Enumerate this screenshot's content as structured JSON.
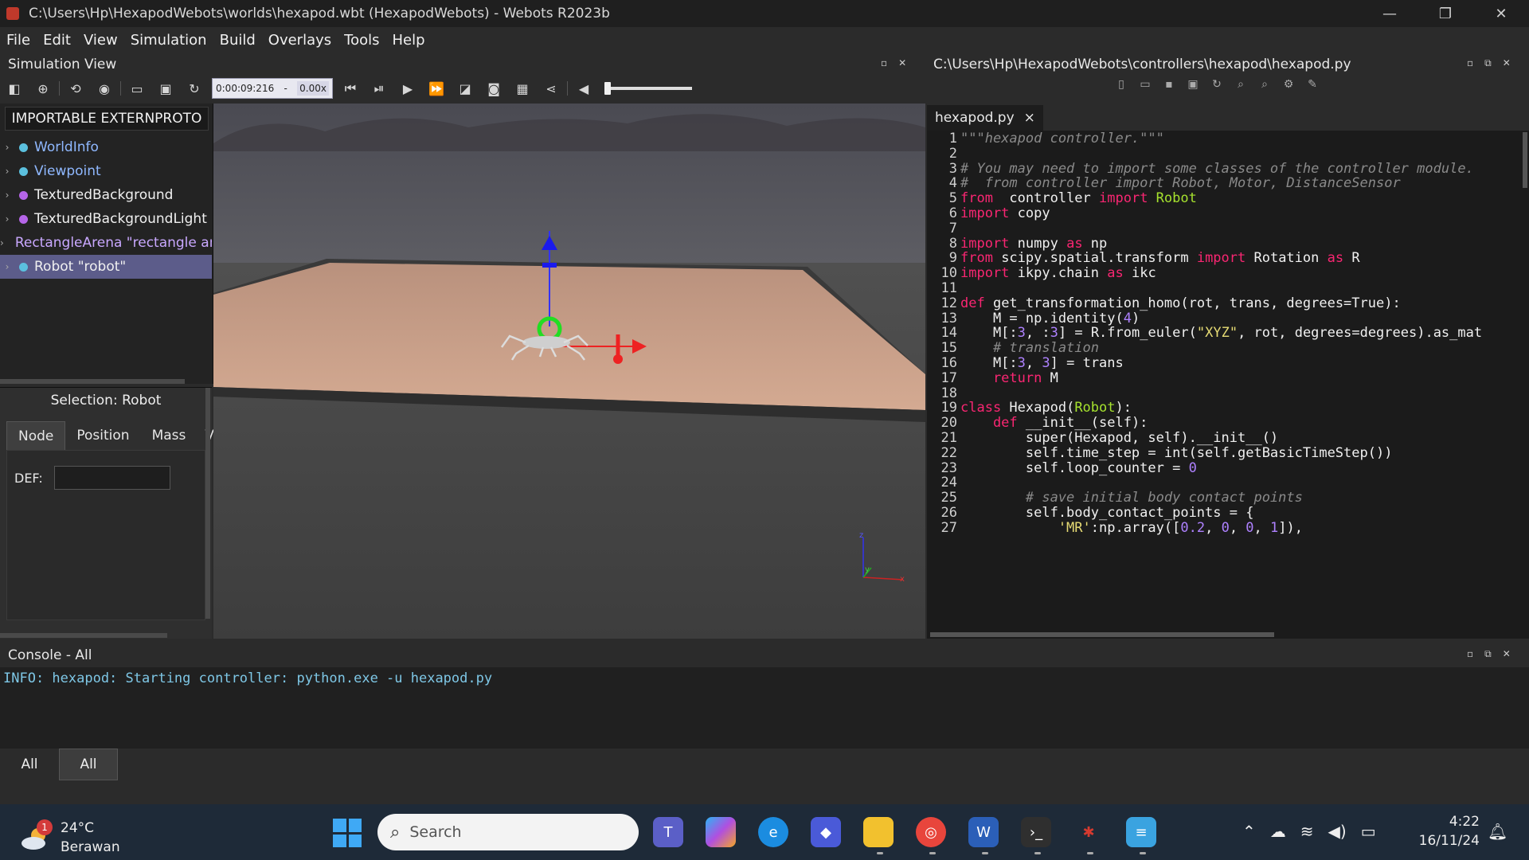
{
  "window": {
    "title": "C:\\Users\\Hp\\HexapodWebots\\worlds\\hexapod.wbt (HexapodWebots) - Webots R2023b",
    "controls": [
      "—",
      "❐",
      "✕"
    ]
  },
  "menu": [
    "File",
    "Edit",
    "View",
    "Simulation",
    "Build",
    "Overlays",
    "Tools",
    "Help"
  ],
  "sim_view": {
    "title": "Simulation View",
    "time": "0:00:09:216",
    "speed_sep": "-",
    "speed": "0.00x",
    "volume_level": 0.0
  },
  "scene_tree": {
    "proto_button": "IMPORTABLE EXTERNPROTO",
    "items": [
      {
        "label": "WorldInfo",
        "color": "#5bc0de",
        "text_color": "#8fb8ff"
      },
      {
        "label": "Viewpoint",
        "color": "#5bc0de",
        "text_color": "#8fb8ff"
      },
      {
        "label": "TexturedBackground",
        "color": "#b565e8",
        "text_color": "#f0f0f0"
      },
      {
        "label": "TexturedBackgroundLight",
        "color": "#b565e8",
        "text_color": "#f0f0f0"
      },
      {
        "label": "RectangleArena \"rectangle ar",
        "color": "#b565e8",
        "text_color": "#c9a8ff"
      },
      {
        "label": "Robot \"robot\"",
        "color": "#5bc0de",
        "text_color": "#f0f0f0",
        "selected": true
      }
    ]
  },
  "field_editor": {
    "selection": "Selection: Robot",
    "tabs": [
      "Node",
      "Position",
      "Mass",
      "V"
    ],
    "def_label": "DEF:",
    "def_value": ""
  },
  "viewport": {
    "axis_labels": {
      "z": "z",
      "y": "y",
      "x": "x"
    }
  },
  "editor": {
    "path": "C:\\Users\\Hp\\HexapodWebots\\controllers\\hexapod\\hexapod.py",
    "tab_name": "hexapod.py",
    "tab_close": "×",
    "lines": [
      {
        "n": "1",
        "segs": [
          [
            "cm",
            "\"\"\"hexapod controller.\"\"\""
          ]
        ]
      },
      {
        "n": "2",
        "segs": []
      },
      {
        "n": "3",
        "segs": [
          [
            "cm",
            "# You may need to import some classes of the controller module."
          ]
        ]
      },
      {
        "n": "4",
        "segs": [
          [
            "cm",
            "#  from controller import Robot, Motor, DistanceSensor"
          ]
        ]
      },
      {
        "n": "5",
        "segs": [
          [
            "kw",
            "from"
          ],
          [
            "",
            "  controller "
          ],
          [
            "kw",
            "import"
          ],
          [
            "cls",
            " Robot"
          ]
        ]
      },
      {
        "n": "6",
        "segs": [
          [
            "kw",
            "import"
          ],
          [
            "",
            " copy"
          ]
        ]
      },
      {
        "n": "7",
        "segs": []
      },
      {
        "n": "8",
        "segs": [
          [
            "kw",
            "import"
          ],
          [
            "",
            " numpy "
          ],
          [
            "kw",
            "as"
          ],
          [
            "",
            " np"
          ]
        ]
      },
      {
        "n": "9",
        "segs": [
          [
            "kw",
            "from"
          ],
          [
            "",
            " scipy.spatial.transform "
          ],
          [
            "kw",
            "import"
          ],
          [
            "",
            " Rotation "
          ],
          [
            "kw",
            "as"
          ],
          [
            "",
            " R"
          ]
        ]
      },
      {
        "n": "10",
        "segs": [
          [
            "kw",
            "import"
          ],
          [
            "",
            " ikpy.chain "
          ],
          [
            "kw",
            "as"
          ],
          [
            "",
            " ikc"
          ]
        ]
      },
      {
        "n": "11",
        "segs": []
      },
      {
        "n": "12",
        "segs": [
          [
            "kw",
            "def"
          ],
          [
            "",
            " get_transformation_homo(rot, trans, degrees=True):"
          ]
        ]
      },
      {
        "n": "13",
        "segs": [
          [
            "",
            "    M = np.identity("
          ],
          [
            "nm",
            "4"
          ],
          [
            "",
            ")"
          ]
        ]
      },
      {
        "n": "14",
        "segs": [
          [
            "",
            "    M[:"
          ],
          [
            "nm",
            "3"
          ],
          [
            "",
            ", :"
          ],
          [
            "nm",
            "3"
          ],
          [
            "",
            "] = R.from_euler("
          ],
          [
            "st",
            "\"XYZ\""
          ],
          [
            "",
            ", rot, degrees=degrees).as_mat"
          ]
        ]
      },
      {
        "n": "15",
        "segs": [
          [
            "cm",
            "    # translation"
          ]
        ]
      },
      {
        "n": "16",
        "segs": [
          [
            "",
            "    M[:"
          ],
          [
            "nm",
            "3"
          ],
          [
            "",
            ", "
          ],
          [
            "nm",
            "3"
          ],
          [
            "",
            "] = trans"
          ]
        ]
      },
      {
        "n": "17",
        "segs": [
          [
            "kw",
            "    return"
          ],
          [
            "",
            " M"
          ]
        ]
      },
      {
        "n": "18",
        "segs": []
      },
      {
        "n": "19",
        "segs": [
          [
            "kw",
            "class"
          ],
          [
            "",
            " Hexapod("
          ],
          [
            "cls",
            "Robot"
          ],
          [
            "",
            "):"
          ]
        ]
      },
      {
        "n": "20",
        "segs": [
          [
            "kw",
            "    def"
          ],
          [
            "",
            " __init__(self):"
          ]
        ]
      },
      {
        "n": "21",
        "segs": [
          [
            "",
            "        super(Hexapod, self).__init__()"
          ]
        ]
      },
      {
        "n": "22",
        "segs": [
          [
            "",
            "        self.time_step = int(self.getBasicTimeStep())"
          ]
        ]
      },
      {
        "n": "23",
        "segs": [
          [
            "",
            "        self.loop_counter = "
          ],
          [
            "nm",
            "0"
          ]
        ]
      },
      {
        "n": "24",
        "segs": []
      },
      {
        "n": "25",
        "segs": [
          [
            "cm",
            "        # save initial body contact points"
          ]
        ]
      },
      {
        "n": "26",
        "segs": [
          [
            "",
            "        self.body_contact_points = {"
          ]
        ]
      },
      {
        "n": "27",
        "segs": [
          [
            "st",
            "            'MR'"
          ],
          [
            "",
            ":np.array(["
          ],
          [
            "nm",
            "0.2"
          ],
          [
            "",
            ", "
          ],
          [
            "nm",
            "0"
          ],
          [
            "",
            ", "
          ],
          [
            "nm",
            "0"
          ],
          [
            "",
            ", "
          ],
          [
            "nm",
            "1"
          ],
          [
            "",
            "]),"
          ]
        ]
      }
    ]
  },
  "console": {
    "title": "Console - All",
    "message": "INFO: hexapod: Starting controller: python.exe -u hexapod.py",
    "tabs": [
      "All",
      "All"
    ]
  },
  "taskbar": {
    "weather_badge": "1",
    "temperature": "24°C",
    "condition": "Berawan",
    "search_placeholder": "Search",
    "time": "4:22",
    "date": "16/11/24"
  },
  "pane_controls": [
    "▫",
    "✕"
  ],
  "pane_controls3": [
    "▫",
    "⧉",
    "✕"
  ]
}
